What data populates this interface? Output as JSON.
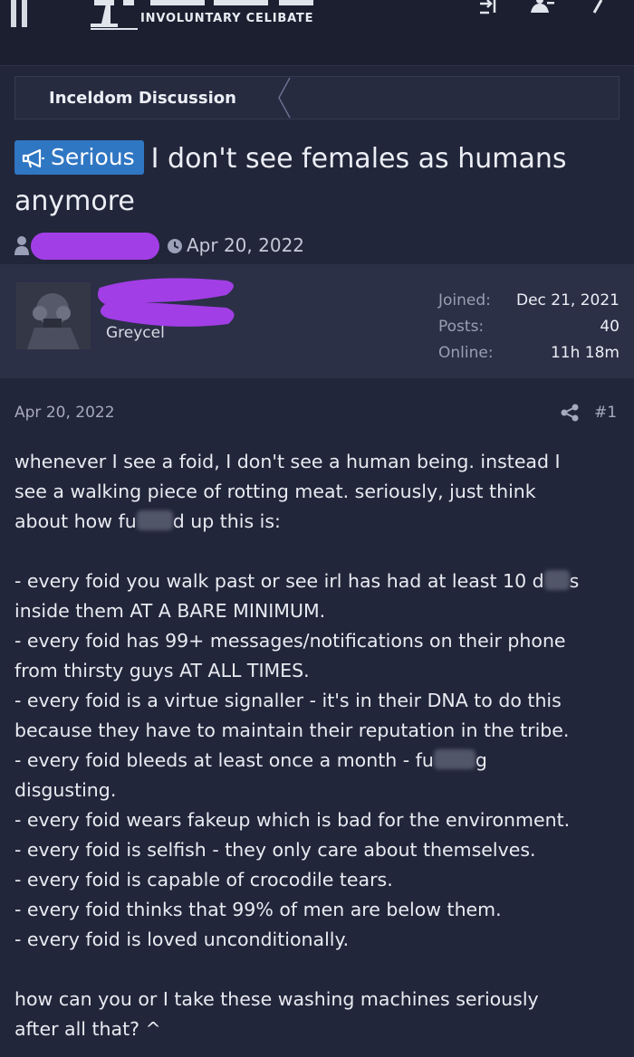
{
  "header": {
    "logo_tagline": "INVOLUNTARY CELIBATE"
  },
  "breadcrumb": {
    "label": "Inceldom Discussion"
  },
  "thread": {
    "prefix": "Serious",
    "title": "I don't see females as humans anymore",
    "date": "Apr 20, 2022"
  },
  "author": {
    "title": "Greycel",
    "stats": [
      {
        "key": "Joined:",
        "value": "Dec 21, 2021"
      },
      {
        "key": "Posts:",
        "value": "40"
      },
      {
        "key": "Online:",
        "value": "11h 18m"
      }
    ]
  },
  "post": {
    "date": "Apr 20, 2022",
    "number": "#1",
    "intro": [
      "whenever I see a foid, I don't see a human being. instead I",
      "see a walking piece of rotting meat. seriously, just think"
    ],
    "intro_last_a": "about how fu",
    "intro_last_b": "d up this is:",
    "list1_a": "- every foid you walk past or see irl has had at least 10 d",
    "list1_b": "s",
    "lines": [
      "inside them AT A BARE MINIMUM.",
      "- every foid has 99+ messages/notifications on their phone",
      "from thirsty guys AT ALL TIMES.",
      "- every foid is a virtue signaller - it's in their DNA to do this",
      "because they have to maintain their reputation in the tribe."
    ],
    "bleed_a": "- every foid bleeds at least once a month - fu",
    "bleed_b": "g",
    "lines2": [
      "disgusting.",
      "- every foid wears fakeup which is bad for the environment.",
      "- every foid is selfish - they only care about themselves.",
      "- every foid is capable of crocodile tears.",
      "- every foid thinks that 99% of men are below them.",
      "- every foid is loved unconditionally."
    ],
    "outro": [
      "how can you or I take these washing machines seriously",
      "after all that? ^"
    ]
  },
  "colors": {
    "background": "#22263a",
    "userbar": "#2b3047",
    "prefix_blue": "#2f76c3",
    "redaction_purple": "#a23ee6"
  },
  "icons": [
    "menu-icon",
    "megaphone-icon",
    "user-icon",
    "clock-icon",
    "share-icon"
  ]
}
